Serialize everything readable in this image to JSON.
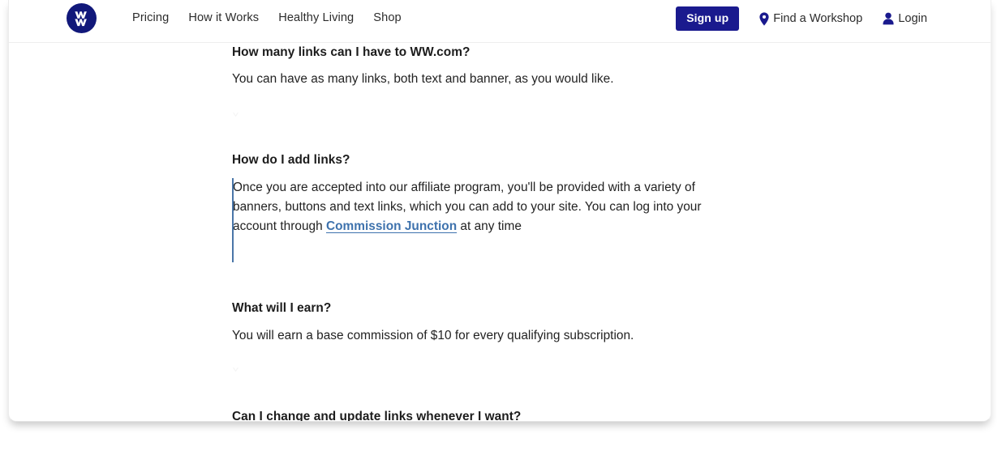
{
  "header": {
    "logo_alt": "WW logo",
    "nav": [
      {
        "label": "Pricing"
      },
      {
        "label": "How it Works"
      },
      {
        "label": "Healthy Living"
      },
      {
        "label": "Shop"
      }
    ],
    "signup_label": "Sign up",
    "find_workshop_label": "Find a Workshop",
    "login_label": "Login",
    "brand_color": "#1a1a8e",
    "logo_color": "#11187a"
  },
  "faq": {
    "items": [
      {
        "question": "How many links can I have to WW.com?",
        "answer": "You can have as many links, both text and banner, as you would like."
      },
      {
        "question": "How do I add links?",
        "answer_part1": "Once you are accepted into our affiliate program, you'll be provided with a variety of banners, buttons and text links, which you can add to your site. You can log into your account through ",
        "link_text": "Commission Junction",
        "answer_part2": " at any time"
      },
      {
        "question": "What will I earn?",
        "answer": "You will earn a base commission of $10 for every qualifying subscription."
      },
      {
        "question": "Can I change and update links whenever I want?"
      }
    ],
    "link_color": "#3e72ad",
    "focus_bar_color": "#4a76a8"
  }
}
